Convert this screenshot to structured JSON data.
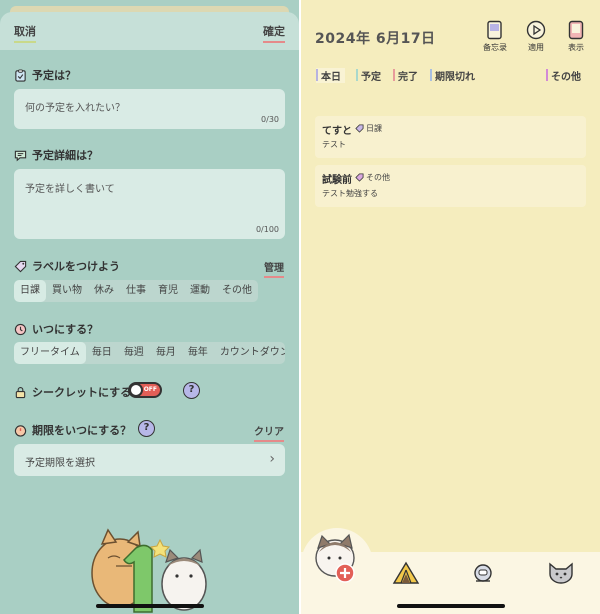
{
  "form": {
    "cancel": "取消",
    "confirm": "確定",
    "title_section": {
      "heading": "予定は？",
      "placeholder": "何の予定を入れたい？",
      "count": "0/30"
    },
    "detail_section": {
      "heading": "予定詳細は？",
      "placeholder": "予定を詳しく書いて",
      "count": "0/100"
    },
    "label_section": {
      "heading": "ラベルをつけよう",
      "manage": "管理",
      "options": [
        "日課",
        "買い物",
        "休み",
        "仕事",
        "育児",
        "運動",
        "その他"
      ],
      "selected": "日課"
    },
    "repeat_section": {
      "heading": "いつにする？",
      "options": [
        "フリータイム",
        "毎日",
        "毎週",
        "毎月",
        "毎年",
        "カウントダウン"
      ],
      "selected": "フリータイム"
    },
    "secret": {
      "label": "シークレットにする",
      "toggle_text": "OFF",
      "help": "?"
    },
    "deadline": {
      "heading": "期限をいつにする？",
      "help": "?",
      "clear": "クリア",
      "placeholder": "予定期限を選択",
      "chevron": "›"
    }
  },
  "schedule": {
    "date": "2024年 6月17日",
    "top_buttons": [
      {
        "label": "备忘录",
        "icon": "memo-icon"
      },
      {
        "label": "適用",
        "icon": "play-icon"
      },
      {
        "label": "表示",
        "icon": "phone-icon"
      }
    ],
    "filters": [
      {
        "label": "本日",
        "color": "#b7b3e0",
        "active": true
      },
      {
        "label": "予定",
        "color": "#a9d8cc"
      },
      {
        "label": "完了",
        "color": "#e89b9b"
      },
      {
        "label": "期限切れ",
        "color": "#a9bfe0"
      },
      {
        "label": "その他",
        "color": "#d28ad6"
      }
    ],
    "items": [
      {
        "title": "てすと",
        "label": "日課",
        "detail": "テスト"
      },
      {
        "title": "試験前",
        "label": "その他",
        "detail": "テスト勉強する"
      }
    ]
  },
  "colors": {
    "left_bg": "#a9cfc4",
    "right_bg": "#f5edbe",
    "accent_red": "#e25f57"
  }
}
